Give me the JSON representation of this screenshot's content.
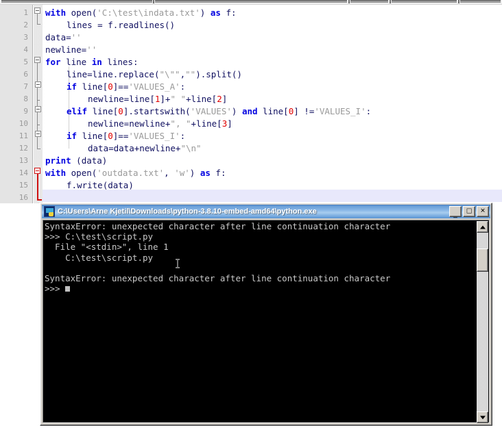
{
  "editor": {
    "name": "python-source-editor",
    "line_count": 16,
    "current_line": 16,
    "line_numbers": [
      "1",
      "2",
      "3",
      "4",
      "5",
      "6",
      "7",
      "8",
      "9",
      "10",
      "11",
      "12",
      "13",
      "14",
      "15",
      "16"
    ],
    "lines": [
      {
        "n": 1,
        "indent": 0,
        "tokens": [
          {
            "t": "with",
            "c": "kw"
          },
          {
            "t": " ",
            "c": "pln"
          },
          {
            "t": "open",
            "c": "pln"
          },
          {
            "t": "(",
            "c": "op"
          },
          {
            "t": "'C:\\test\\indata.txt'",
            "c": "str"
          },
          {
            "t": ")",
            "c": "op"
          },
          {
            "t": " ",
            "c": "pln"
          },
          {
            "t": "as",
            "c": "kw"
          },
          {
            "t": " ",
            "c": "pln"
          },
          {
            "t": "f",
            "c": "pln"
          },
          {
            "t": ":",
            "c": "op"
          }
        ]
      },
      {
        "n": 2,
        "indent": 2,
        "tokens": [
          {
            "t": "lines = f",
            "c": "pln"
          },
          {
            "t": ".",
            "c": "op"
          },
          {
            "t": "readlines",
            "c": "pln"
          },
          {
            "t": "()",
            "c": "op"
          }
        ]
      },
      {
        "n": 3,
        "indent": 0,
        "tokens": [
          {
            "t": "data=",
            "c": "pln"
          },
          {
            "t": "''",
            "c": "str"
          }
        ]
      },
      {
        "n": 4,
        "indent": 0,
        "tokens": [
          {
            "t": "newline=",
            "c": "pln"
          },
          {
            "t": "''",
            "c": "str"
          }
        ]
      },
      {
        "n": 5,
        "indent": 0,
        "tokens": [
          {
            "t": "for",
            "c": "kw"
          },
          {
            "t": " line ",
            "c": "pln"
          },
          {
            "t": "in",
            "c": "kw"
          },
          {
            "t": " lines",
            "c": "pln"
          },
          {
            "t": ":",
            "c": "op"
          }
        ]
      },
      {
        "n": 6,
        "indent": 2,
        "tokens": [
          {
            "t": "line=line",
            "c": "pln"
          },
          {
            "t": ".",
            "c": "op"
          },
          {
            "t": "replace",
            "c": "pln"
          },
          {
            "t": "(",
            "c": "op"
          },
          {
            "t": "\"\\\"\"",
            "c": "str"
          },
          {
            "t": ",",
            "c": "op"
          },
          {
            "t": "\"\"",
            "c": "str"
          },
          {
            "t": ")",
            "c": "op"
          },
          {
            "t": ".",
            "c": "op"
          },
          {
            "t": "split",
            "c": "pln"
          },
          {
            "t": "()",
            "c": "op"
          }
        ]
      },
      {
        "n": 7,
        "indent": 2,
        "tokens": [
          {
            "t": "if",
            "c": "kw"
          },
          {
            "t": " line",
            "c": "pln"
          },
          {
            "t": "[",
            "c": "op"
          },
          {
            "t": "0",
            "c": "num"
          },
          {
            "t": "]",
            "c": "op"
          },
          {
            "t": "==",
            "c": "pln"
          },
          {
            "t": "'VALUES_A'",
            "c": "str"
          },
          {
            "t": ":",
            "c": "op"
          }
        ]
      },
      {
        "n": 8,
        "indent": 4,
        "tokens": [
          {
            "t": "newline=line",
            "c": "pln"
          },
          {
            "t": "[",
            "c": "op"
          },
          {
            "t": "1",
            "c": "num"
          },
          {
            "t": "]",
            "c": "op"
          },
          {
            "t": "+",
            "c": "pln"
          },
          {
            "t": "\" \"",
            "c": "str"
          },
          {
            "t": "+line",
            "c": "pln"
          },
          {
            "t": "[",
            "c": "op"
          },
          {
            "t": "2",
            "c": "num"
          },
          {
            "t": "]",
            "c": "op"
          }
        ]
      },
      {
        "n": 9,
        "indent": 2,
        "tokens": [
          {
            "t": "elif",
            "c": "kw"
          },
          {
            "t": " line",
            "c": "pln"
          },
          {
            "t": "[",
            "c": "op"
          },
          {
            "t": "0",
            "c": "num"
          },
          {
            "t": "]",
            "c": "op"
          },
          {
            "t": ".",
            "c": "op"
          },
          {
            "t": "startswith",
            "c": "pln"
          },
          {
            "t": "(",
            "c": "op"
          },
          {
            "t": "'VALUES'",
            "c": "str"
          },
          {
            "t": ")",
            "c": "op"
          },
          {
            "t": " ",
            "c": "pln"
          },
          {
            "t": "and",
            "c": "kw"
          },
          {
            "t": " line",
            "c": "pln"
          },
          {
            "t": "[",
            "c": "op"
          },
          {
            "t": "0",
            "c": "num"
          },
          {
            "t": "]",
            "c": "op"
          },
          {
            "t": " !=",
            "c": "pln"
          },
          {
            "t": "'VALUES_I'",
            "c": "str"
          },
          {
            "t": ":",
            "c": "op"
          }
        ]
      },
      {
        "n": 10,
        "indent": 4,
        "tokens": [
          {
            "t": "newline=newline+",
            "c": "pln"
          },
          {
            "t": "\", \"",
            "c": "str"
          },
          {
            "t": "+line",
            "c": "pln"
          },
          {
            "t": "[",
            "c": "op"
          },
          {
            "t": "3",
            "c": "num"
          },
          {
            "t": "]",
            "c": "op"
          }
        ]
      },
      {
        "n": 11,
        "indent": 2,
        "tokens": [
          {
            "t": "if",
            "c": "kw"
          },
          {
            "t": " line",
            "c": "pln"
          },
          {
            "t": "[",
            "c": "op"
          },
          {
            "t": "0",
            "c": "num"
          },
          {
            "t": "]",
            "c": "op"
          },
          {
            "t": "==",
            "c": "pln"
          },
          {
            "t": "'VALUES_I'",
            "c": "str"
          },
          {
            "t": ":",
            "c": "op"
          }
        ]
      },
      {
        "n": 12,
        "indent": 4,
        "tokens": [
          {
            "t": "data=data+newline+",
            "c": "pln"
          },
          {
            "t": "\"\\n\"",
            "c": "str"
          }
        ]
      },
      {
        "n": 13,
        "indent": 0,
        "tokens": [
          {
            "t": "print",
            "c": "kw"
          },
          {
            "t": " (data)",
            "c": "pln"
          }
        ]
      },
      {
        "n": 14,
        "indent": 0,
        "tokens": [
          {
            "t": "with",
            "c": "kw"
          },
          {
            "t": " ",
            "c": "pln"
          },
          {
            "t": "open",
            "c": "pln"
          },
          {
            "t": "(",
            "c": "op"
          },
          {
            "t": "'outdata.txt'",
            "c": "str"
          },
          {
            "t": ",",
            "c": "op"
          },
          {
            "t": " ",
            "c": "pln"
          },
          {
            "t": "'w'",
            "c": "str"
          },
          {
            "t": ")",
            "c": "op"
          },
          {
            "t": " ",
            "c": "pln"
          },
          {
            "t": "as",
            "c": "kw"
          },
          {
            "t": " f",
            "c": "pln"
          },
          {
            "t": ":",
            "c": "op"
          }
        ]
      },
      {
        "n": 15,
        "indent": 2,
        "tokens": [
          {
            "t": "f",
            "c": "pln"
          },
          {
            "t": ".",
            "c": "op"
          },
          {
            "t": "write",
            "c": "pln"
          },
          {
            "t": "(data)",
            "c": "pln"
          }
        ]
      },
      {
        "n": 16,
        "indent": 0,
        "tokens": []
      }
    ],
    "colors": {
      "keyword": "#0000e0",
      "string": "#999999",
      "number": "#e00000",
      "plain": "#101060",
      "gutter_bg": "#e4e4e4",
      "gutter_fg": "#9a9a9a",
      "current_line_bg": "#e8e8fb",
      "fold_marker": "#8a8a8a",
      "fold_marker_active": "#d01010",
      "editor_bg": "#ffffff"
    }
  },
  "console_window": {
    "title": "C:\\Users\\Arne Kjetil\\Downloads\\python-3.8.10-embed-amd64\\python.exe",
    "icon": "python-console-icon",
    "buttons": {
      "minimize": "_",
      "maximize": "□",
      "close": "✕"
    },
    "background": "#000000",
    "foreground": "#c8c8c8",
    "output_lines": [
      "SyntaxError: unexpected character after line continuation character",
      ">>> C:\\test\\script.py",
      "  File \"<stdin>\", line 1",
      "    C:\\test\\script.py",
      "",
      "SyntaxError: unexpected character after line continuation character",
      ">>> "
    ],
    "cursor": "block",
    "scrollbar": {
      "up_arrow": "▲",
      "down_arrow": "▼",
      "thumb_position_pct": 13
    }
  }
}
